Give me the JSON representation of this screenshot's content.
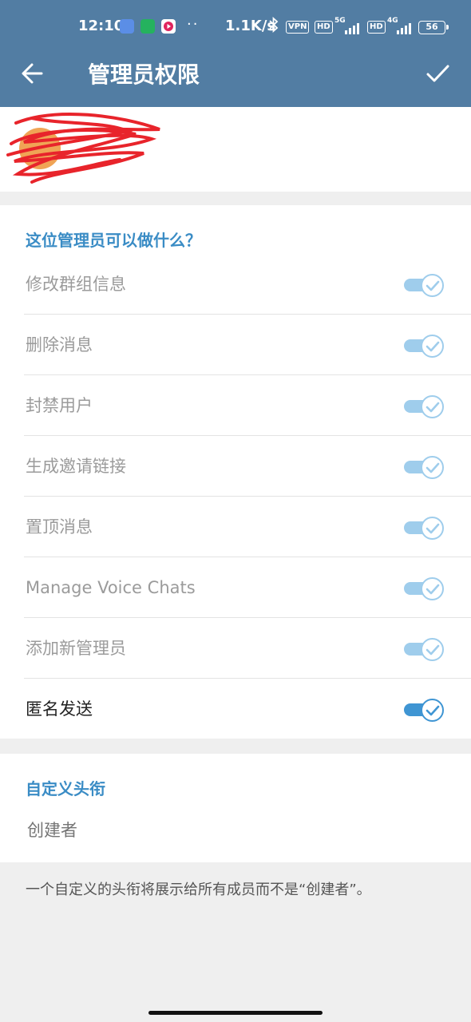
{
  "status_bar": {
    "time": "12:10",
    "dots": "··",
    "speed": "1.1K/s",
    "vpn": "VPN",
    "hd": "HD",
    "net1": "5G",
    "net2": "4G",
    "battery": "56"
  },
  "app_bar": {
    "title": "管理员权限",
    "back_icon": "arrow-left-icon",
    "done_icon": "check-icon"
  },
  "user": {
    "name": "",
    "status": "",
    "avatar_color": "#f0a455"
  },
  "permissions": {
    "section_title": "这位管理员可以做什么？",
    "items": [
      {
        "label": "修改群组信息",
        "on": true,
        "enabled": false
      },
      {
        "label": "删除消息",
        "on": true,
        "enabled": false
      },
      {
        "label": "封禁用户",
        "on": true,
        "enabled": false
      },
      {
        "label": "生成邀请链接",
        "on": true,
        "enabled": false
      },
      {
        "label": "置顶消息",
        "on": true,
        "enabled": false
      },
      {
        "label": "Manage Voice Chats",
        "on": true,
        "enabled": false
      },
      {
        "label": "添加新管理员",
        "on": true,
        "enabled": false
      },
      {
        "label": "匿名发送",
        "on": true,
        "enabled": true
      }
    ]
  },
  "custom_title": {
    "section_title": "自定义头衔",
    "placeholder": "创建者",
    "hint": "一个自定义的头衔将展示给所有成员而不是“创建者”。"
  },
  "colors": {
    "header": "#527da3",
    "accent": "#3a8cc5",
    "toggle_on": "#3f95d3",
    "toggle_disabled": "#9fcdec",
    "scribble": "#e8242b"
  }
}
